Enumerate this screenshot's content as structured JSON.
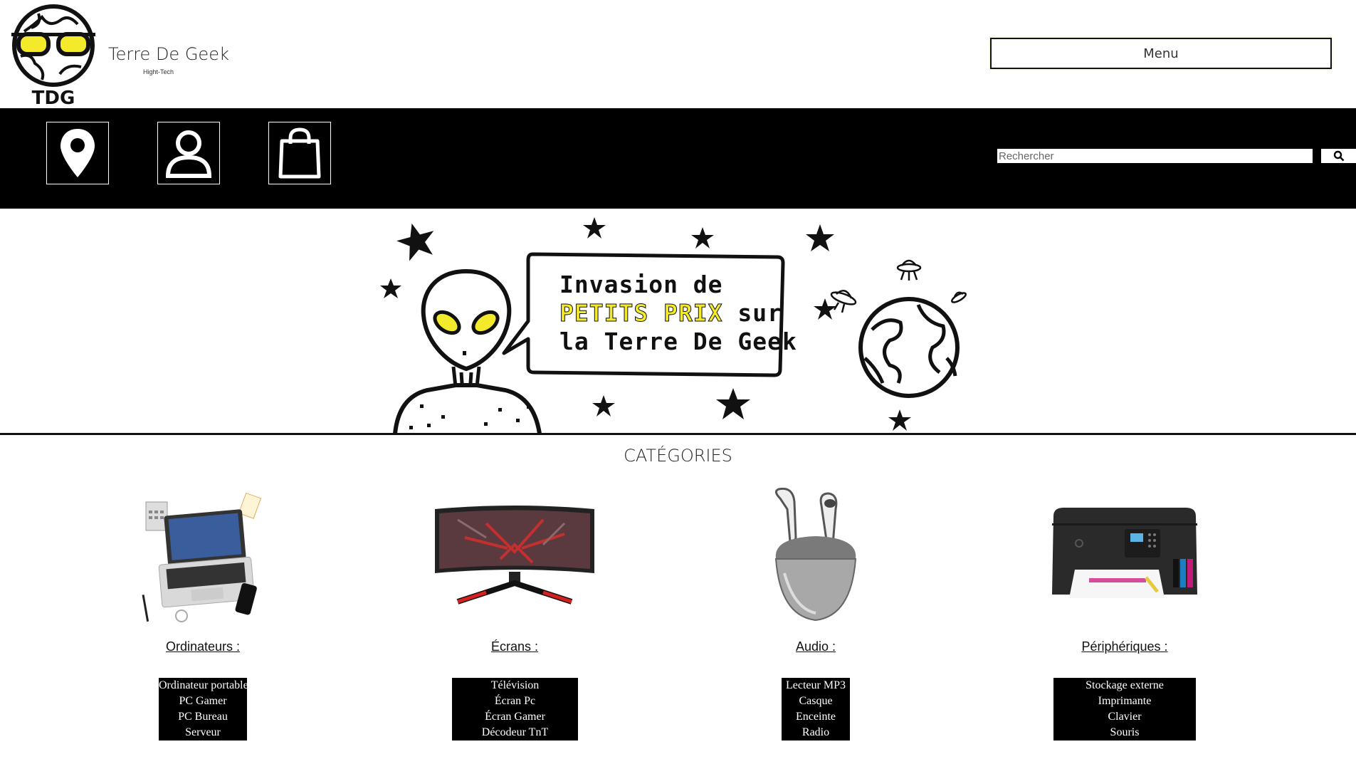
{
  "header": {
    "logo_text": "TDG",
    "brand_title": "Terre De Geek",
    "brand_subtitle": "Hight-Tech",
    "menu_label": "Menu"
  },
  "nav": {
    "icons": [
      "location-pin-icon",
      "user-icon",
      "shopping-bag-icon"
    ],
    "search_placeholder": "Rechercher"
  },
  "hero": {
    "line1": "Invasion de",
    "line2_highlight": "PETITS PRIX",
    "line2_rest": " sur",
    "line3": "la Terre De Geek"
  },
  "categories": {
    "heading": "CATÉGORIES",
    "items": [
      {
        "title": "Ordinateurs :",
        "links": [
          "Ordinateur portable",
          "PC Gamer",
          "PC Bureau",
          "Serveur"
        ]
      },
      {
        "title": "Écrans :",
        "links": [
          "Télévision",
          "Écran Pc",
          "Écran Gamer",
          "Décodeur TnT"
        ]
      },
      {
        "title": "Audio :",
        "links": [
          "Lecteur MP3",
          "Casque",
          "Enceinte",
          "Radio"
        ]
      },
      {
        "title": "Périphériques :",
        "links": [
          "Stockage externe",
          "Imprimante",
          "Clavier",
          "Souris"
        ]
      }
    ]
  },
  "colors": {
    "accent_yellow": "#f2ea2a",
    "nav_bg": "#000000"
  }
}
